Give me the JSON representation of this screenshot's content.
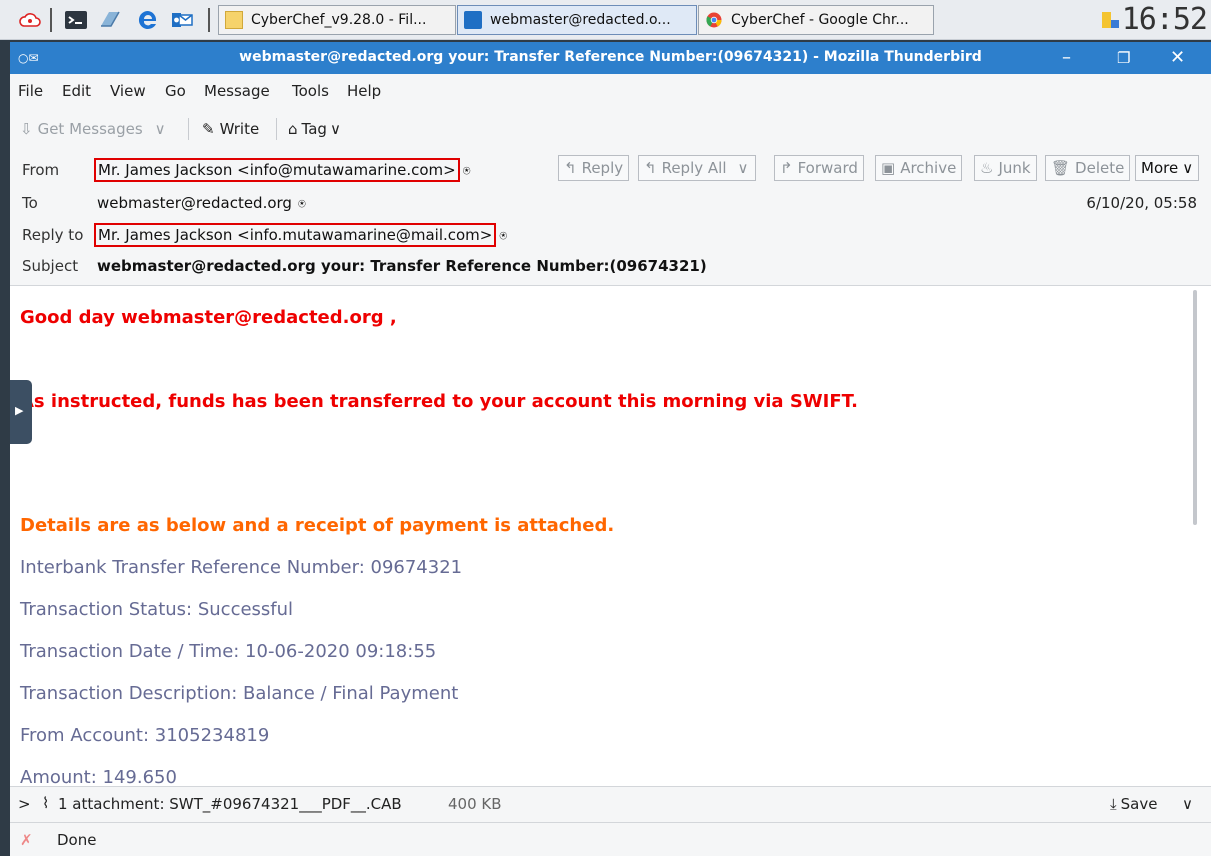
{
  "taskbar": {
    "tasks": [
      {
        "label": "CyberChef_v9.28.0 - Fil..."
      },
      {
        "label": "webmaster@redacted.o..."
      },
      {
        "label": "CyberChef - Google Chr..."
      }
    ],
    "clock": "16:52"
  },
  "window": {
    "title": "webmaster@redacted.org your: Transfer Reference Number:(09674321) - Mozilla Thunderbird"
  },
  "menu": {
    "file": "File",
    "edit": "Edit",
    "view": "View",
    "go": "Go",
    "message": "Message",
    "tools": "Tools",
    "help": "Help"
  },
  "toolbar": {
    "get_messages": "Get Messages",
    "write": "Write",
    "tag": "Tag"
  },
  "header": {
    "from_label": "From",
    "from_value": "Mr. James Jackson <info@mutawamarine.com>",
    "to_label": "To",
    "to_value": "webmaster@redacted.org",
    "reply_to_label": "Reply to",
    "reply_to_value": "Mr. James Jackson <info.mutawamarine@mail.com>",
    "subject_label": "Subject",
    "subject_value": "webmaster@redacted.org your: Transfer Reference Number:(09674321)",
    "date": "6/10/20, 05:58",
    "buttons": {
      "reply": "Reply",
      "reply_all": "Reply All",
      "forward": "Forward",
      "archive": "Archive",
      "junk": "Junk",
      "delete": "Delete",
      "more": "More"
    }
  },
  "body": {
    "greeting": "Good day webmaster@redacted.org ,",
    "instructed": "As instructed, funds has been transferred to your account this morning via SWIFT.",
    "details": "Details are as below and a receipt of payment is attached.",
    "lines": [
      "Interbank Transfer Reference Number: 09674321",
      "Transaction Status: Successful",
      "Transaction Date / Time: 10-06-2020 09:18:55",
      "Transaction Description: Balance / Final Payment",
      "From Account: 3105234819",
      "Amount: 149.650"
    ]
  },
  "attachment": {
    "summary": "1 attachment: SWT_#09674321___PDF__.CAB",
    "size": "400 KB",
    "save": "Save"
  },
  "status": {
    "text": "Done"
  },
  "colors": {
    "titlebar": "#2d7fcc",
    "highlight": "#e00000",
    "red_text": "#ee0000",
    "orange_text": "#ff6600",
    "grey_text": "#666b94"
  }
}
